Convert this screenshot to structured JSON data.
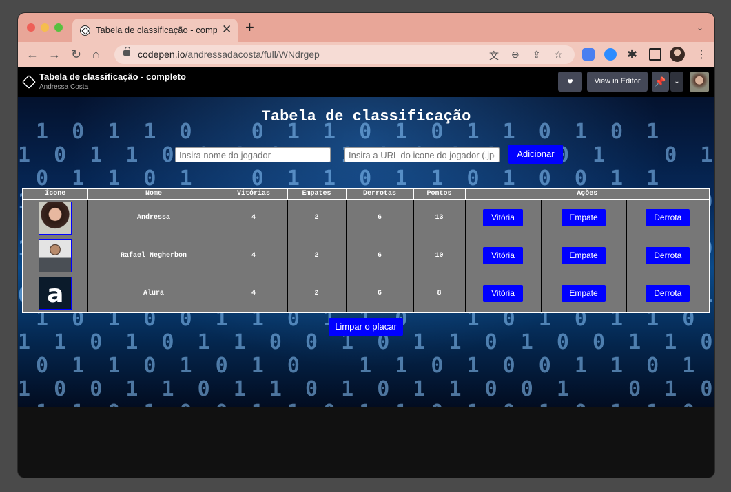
{
  "browser": {
    "tab_title": "Tabela de classificação - completo",
    "url_host": "codepen.io",
    "url_path": "/andressadacosta/full/WNdrgep"
  },
  "codepen": {
    "pen_title": "Tabela de classificação - completo",
    "author": "Andressa Costa",
    "view_in_editor": "View in Editor"
  },
  "page": {
    "heading": "Tabela de classificação",
    "name_placeholder": "Insira nome do jogador",
    "icon_placeholder": "Insira a URL do icone do jogador (.jpg)",
    "add_label": "Adicionar",
    "reset_label": "Limpar o placar"
  },
  "table": {
    "headers": [
      "Ícone",
      "Nome",
      "Vitórias",
      "Empates",
      "Derrotas",
      "Pontos",
      "Ações"
    ],
    "action_labels": {
      "win": "Vitória",
      "draw": "Empate",
      "loss": "Derrota"
    },
    "rows": [
      {
        "name": "Andressa",
        "wins": "4",
        "draws": "2",
        "losses": "6",
        "points": "13"
      },
      {
        "name": "Rafael Negherbon",
        "wins": "4",
        "draws": "2",
        "losses": "6",
        "points": "10"
      },
      {
        "name": "Alura",
        "wins": "4",
        "draws": "2",
        "losses": "6",
        "points": "8"
      }
    ]
  },
  "colors": {
    "accent": "#0000ff",
    "tab_strip": "#e8a698",
    "codepen_bar": "#000000"
  }
}
